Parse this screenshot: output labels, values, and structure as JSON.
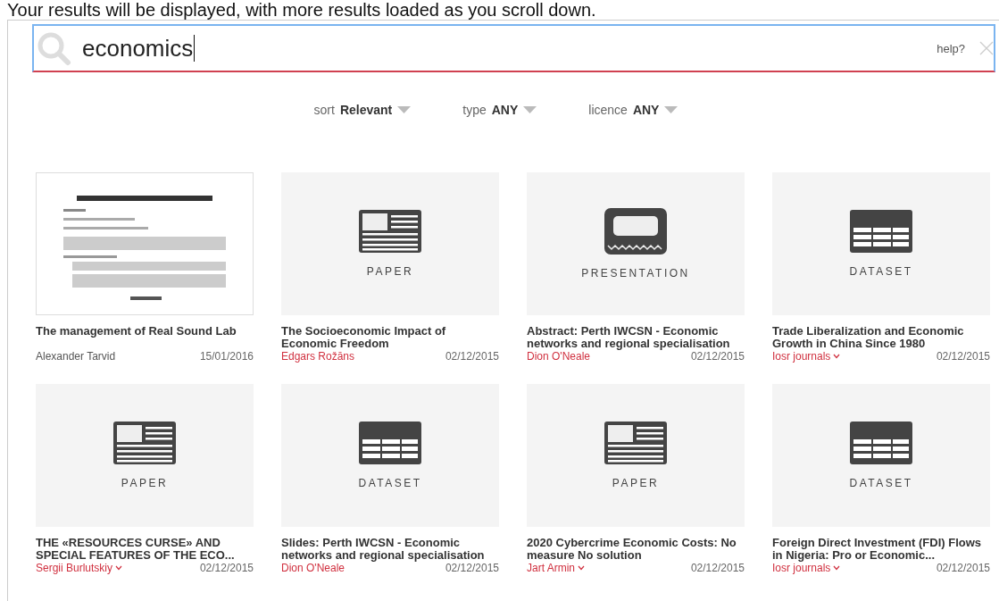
{
  "notice": "Your results will be displayed, with more results loaded as you scroll down.",
  "search": {
    "value": "economics",
    "help": "help?"
  },
  "filters": [
    {
      "label": "sort",
      "value": "Relevant"
    },
    {
      "label": "type",
      "value": "ANY"
    },
    {
      "label": "licence",
      "value": "ANY"
    }
  ],
  "results": [
    {
      "kind": "picture",
      "title": "The management of Real Sound Lab",
      "author": "Alexander Tarvid",
      "author_linked": false,
      "has_menu": false,
      "date": "15/01/2016"
    },
    {
      "kind": "paper",
      "type_label": "PAPER",
      "title": "The Socioeconomic Impact of Economic Freedom",
      "author": "Edgars Rožāns",
      "author_linked": true,
      "has_menu": false,
      "date": "02/12/2015"
    },
    {
      "kind": "presentation",
      "type_label": "PRESENTATION",
      "title": "Abstract: Perth IWCSN - Economic networks and regional specialisation",
      "author": "Dion O'Neale",
      "author_linked": true,
      "has_menu": false,
      "date": "02/12/2015"
    },
    {
      "kind": "dataset",
      "type_label": "DATASET",
      "title": "Trade Liberalization and Economic Growth in China Since 1980",
      "author": "Iosr journals",
      "author_linked": true,
      "has_menu": true,
      "date": "02/12/2015"
    },
    {
      "kind": "paper",
      "type_label": "PAPER",
      "title": "THE «RESOURCES CURSE» AND SPECIAL FEATURES OF THE ECO...",
      "author": "Sergii Burlutskiy",
      "author_linked": true,
      "has_menu": true,
      "date": "02/12/2015"
    },
    {
      "kind": "dataset",
      "type_label": "DATASET",
      "title": "Slides: Perth IWCSN - Economic networks and regional specialisation",
      "author": "Dion O'Neale",
      "author_linked": true,
      "has_menu": false,
      "date": "02/12/2015"
    },
    {
      "kind": "paper",
      "type_label": "PAPER",
      "title": "2020 Cybercrime Economic Costs: No measure No solution",
      "author": "Jart Armin",
      "author_linked": true,
      "has_menu": true,
      "date": "02/12/2015"
    },
    {
      "kind": "dataset",
      "type_label": "DATASET",
      "title": "Foreign Direct Investment (FDI) Flows in Nigeria: Pro or Economic...",
      "author": "Iosr journals",
      "author_linked": true,
      "has_menu": true,
      "date": "02/12/2015"
    }
  ]
}
